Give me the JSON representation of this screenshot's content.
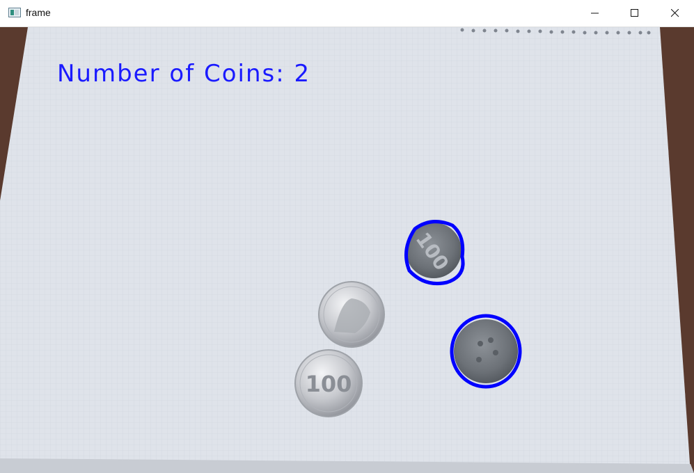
{
  "window": {
    "title": "frame",
    "controls": {
      "minimize_icon": "minimize-icon",
      "maximize_icon": "maximize-icon",
      "close_icon": "close-icon"
    }
  },
  "frame": {
    "overlay_label": "Number of Coins: 2",
    "coin_labels": [
      "100",
      "100"
    ],
    "colors": {
      "overlay_text": "#1a1aff",
      "detection_circle": "#0000ff",
      "paper": "#dfe3ea",
      "desk": "#5a3a2e"
    }
  }
}
